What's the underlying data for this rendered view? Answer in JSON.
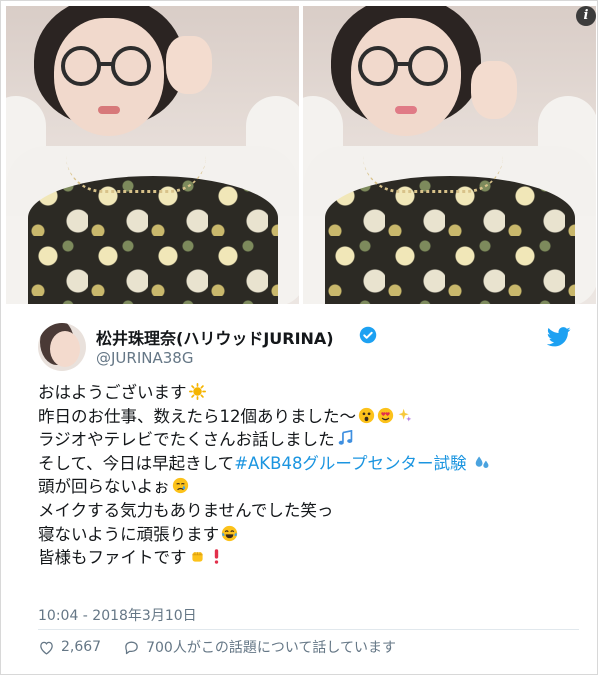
{
  "author": {
    "display_name": "松井珠理奈(ハリウッドJURINA)",
    "handle": "@JURINA38G"
  },
  "tweet": {
    "lines": [
      {
        "text": "おはようございます"
      },
      {
        "text": "昨日のお仕事、数えたら12個ありました〜"
      },
      {
        "text": "ラジオやテレビでたくさんお話しました"
      },
      {
        "text": "そして、今日は早起きして",
        "hashtag": "#AKB48グループセンター試験"
      },
      {
        "text": "頭が回らないよぉ"
      },
      {
        "text": "メイクする気力もありませんでした笑っ"
      },
      {
        "text": "寝ないように頑張ります"
      },
      {
        "text": "皆様もファイトです"
      }
    ]
  },
  "timestamp": "10:04 - 2018年3月10日",
  "actions": {
    "likes": "2,667",
    "replies_text": "700人がこの話題について話しています"
  },
  "colors": {
    "link": "#1b95e0",
    "twitter_blue": "#1da1f2",
    "secondary_text": "#657786"
  },
  "icons": {
    "verified": "verified-badge-icon",
    "bird": "twitter-bird-icon",
    "like": "heart-icon",
    "reply": "speech-bubble-icon",
    "info": "info-icon"
  }
}
